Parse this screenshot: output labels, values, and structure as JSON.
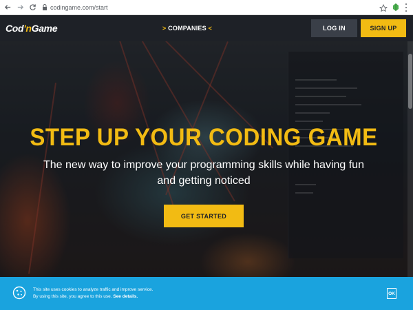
{
  "browser": {
    "url": "codingame.com/start",
    "back_icon": "arrow-left-icon",
    "forward_icon": "arrow-right-icon",
    "reload_icon": "reload-icon"
  },
  "nav": {
    "logo_main": "Cod",
    "logo_accent": "'n",
    "logo_end": "Game",
    "companies_prefix": ">",
    "companies_label": "COMPANIES",
    "companies_suffix": "<",
    "login_label": "LOG IN",
    "signup_label": "SIGN UP"
  },
  "hero": {
    "headline": "STEP UP YOUR CODING GAME",
    "subline": "The new way to improve your programming skills while having fun and getting noticed",
    "cta_label": "GET STARTED"
  },
  "cookie": {
    "line1": "This site uses cookies to analyze traffic and improve service.",
    "line2_prefix": "By using this site, you agree to this use.",
    "line2_link": "See details.",
    "ok_label": "OK"
  },
  "colors": {
    "accent": "#f2bb13",
    "nav_bg": "#1e2127",
    "banner_bg": "#1aa3de"
  }
}
